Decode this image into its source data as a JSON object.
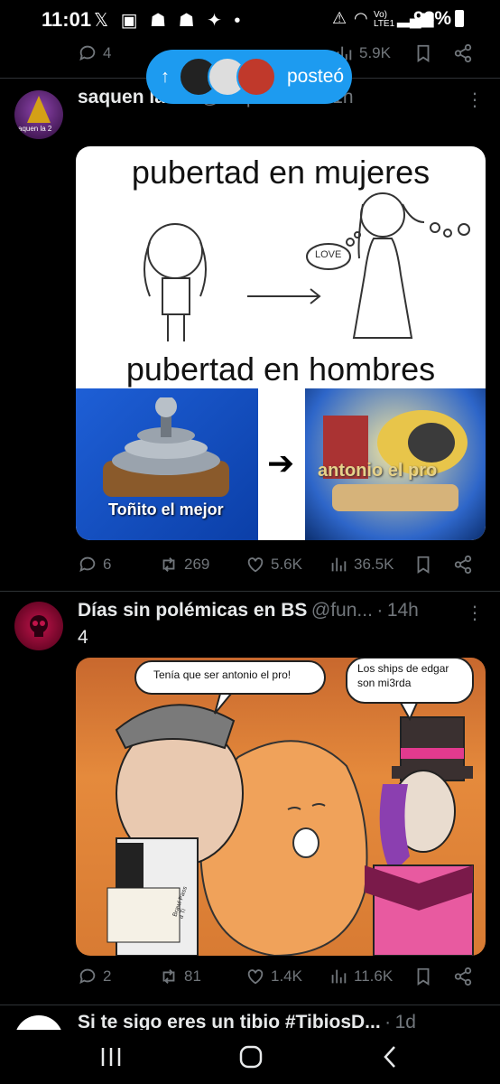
{
  "status_bar": {
    "time": "11:01",
    "battery": "98%",
    "network": "Vo) LTE1"
  },
  "top_post_actions": {
    "replies": "4",
    "views": "5.9K"
  },
  "posted_pill": {
    "arrow": "↑",
    "label": "posteó"
  },
  "post1": {
    "author_name": "saquen la 2.0",
    "handle": "@saquenla2",
    "time": "21h",
    "avatar_label": "aquen la 2",
    "meme_top": "pubertad en mujeres",
    "meme_bottom": "pubertad en hombres",
    "bubble_text": "LOVE",
    "left_caption": "Toñito el mejor",
    "right_caption": "antonio el pro",
    "replies": "6",
    "reposts": "269",
    "likes": "5.6K",
    "views": "36.5K"
  },
  "post2": {
    "author_name": "Días sin polémicas en BS",
    "handle": "@fun...",
    "time": "14h",
    "text": "4",
    "bubble_left": "Tenía que ser antonio el pro!",
    "bubble_right": "Los ships de edgar son mi3rda",
    "paper_text": "Brawl Pass a Ti",
    "replies": "2",
    "reposts": "81",
    "likes": "1.4K",
    "views": "11.6K"
  },
  "post3": {
    "author_name": "Si te sigo eres un tibio #TibiosD...",
    "time": "1d"
  },
  "colors": {
    "accent": "#1d9bf0",
    "muted": "#71767b",
    "background": "#000000"
  }
}
